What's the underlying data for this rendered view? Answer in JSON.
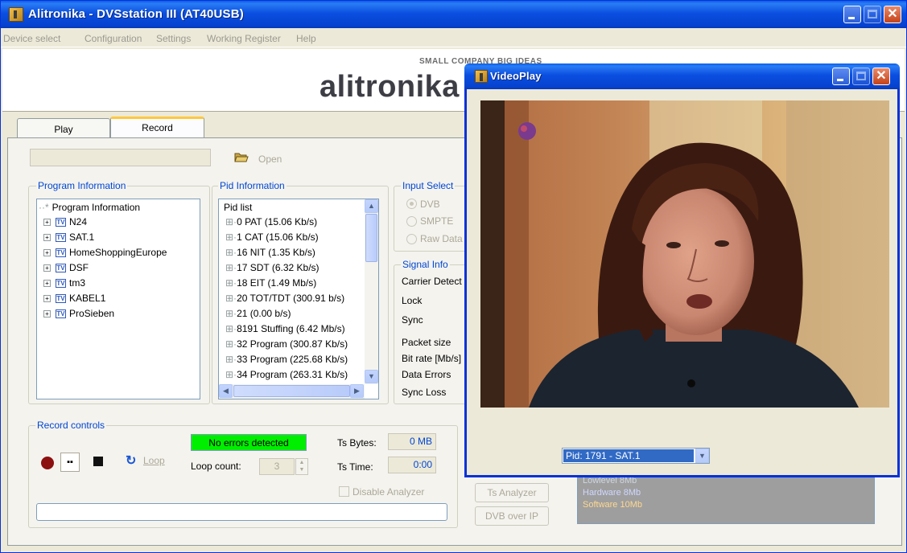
{
  "main_window": {
    "title": "Alitronika - DVSstation III  (AT40USB)",
    "menu": [
      "Device select",
      "Configuration",
      "Settings",
      "Working Register",
      "Help"
    ]
  },
  "banner": {
    "tagline": "SMALL COMPANY BIG IDEAS",
    "brand": "alitronika"
  },
  "tabs": [
    "Play",
    "Record"
  ],
  "selected_tab": "Record",
  "file": {
    "path": "",
    "open_label": "Open"
  },
  "program_info": {
    "group_label": "Program Information",
    "root": "Program Information",
    "items": [
      "N24",
      "SAT.1",
      "HomeShoppingEurope",
      "DSF",
      "tm3",
      "KABEL1",
      "ProSieben"
    ]
  },
  "pid_info": {
    "group_label": "Pid Information",
    "root": "Pid list",
    "items": [
      "0 PAT (15.06 Kb/s)",
      "1 CAT (15.06 Kb/s)",
      "16 NIT (1.35 Kb/s)",
      "17 SDT (6.32 Kb/s)",
      "18 EIT (1.49 Mb/s)",
      "20 TOT/TDT (300.91 b/s)",
      "21  (0.00 b/s)",
      "8191 Stuffing (6.42 Mb/s)",
      "32 Program (300.87 Kb/s)",
      "33 Program (225.68 Kb/s)",
      "34 Program (263.31 Kb/s)"
    ]
  },
  "input_select": {
    "group_label": "Input Select",
    "options": [
      "DVB",
      "SMPTE",
      "Raw Data"
    ],
    "selected": "DVB"
  },
  "signal_info": {
    "group_label": "Signal Info",
    "labels": [
      "Carrier Detect",
      "Lock",
      "Sync",
      "Packet size",
      "Bit rate [Mb/s]",
      "Data Errors",
      "Sync Loss"
    ]
  },
  "record_controls": {
    "group_label": "Record controls",
    "loop_label": "Loop",
    "status": "No errors detected",
    "loop_count_label": "Loop count:",
    "loop_count": "3",
    "ts_bytes_label": "Ts Bytes:",
    "ts_bytes": "0 MB",
    "ts_time_label": "Ts Time:",
    "ts_time": "0:00",
    "disable_analyzer": "Disable Analyzer"
  },
  "buttons": {
    "ts_analyzer": "Ts Analyzer",
    "dvb_over_ip": "DVB over IP"
  },
  "memory": [
    "Lowlevel 8Mb",
    "Hardware 8Mb",
    "Software 10Mb"
  ],
  "video_window": {
    "title": "VideoPlay",
    "pid_selected": "Pid: 1791 - SAT.1"
  },
  "colors": {
    "titlebar": "#0a5ce8",
    "group_label": "#0046d5",
    "status_ok": "#00ee00",
    "selection": "#316ac5"
  }
}
